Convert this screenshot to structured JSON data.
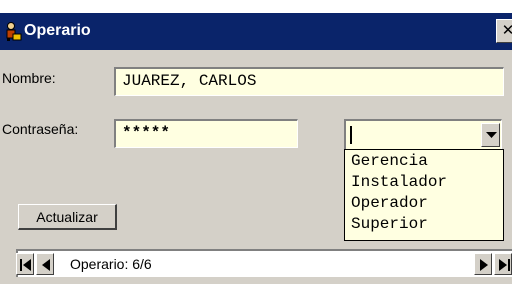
{
  "window": {
    "title": "Operario",
    "close_glyph": "✕"
  },
  "form": {
    "nombre": {
      "label": "Nombre:",
      "value": "JUAREZ, CARLOS"
    },
    "contrasena": {
      "label": "Contraseña:",
      "value": "*****"
    },
    "role_dropdown": {
      "value": "",
      "options": [
        "Gerencia",
        "Instalador",
        "Operador",
        "Superior"
      ]
    },
    "update_button": "Actualizar"
  },
  "navigator": {
    "record_label": "Operario: 6/6"
  },
  "colors": {
    "titlebar": "#0a246a",
    "field_bg": "#ffffe1",
    "window_bg": "#d4d0c8"
  },
  "icons": [
    "person-icon",
    "close-icon",
    "dropdown-arrow-icon",
    "first-record-icon",
    "prev-record-icon",
    "next-record-icon",
    "last-record-icon"
  ]
}
